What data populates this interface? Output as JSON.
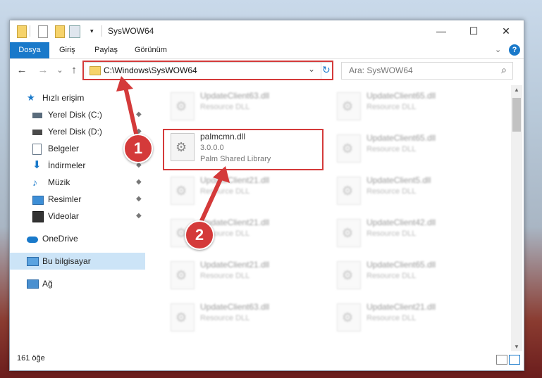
{
  "window": {
    "title": "SysWOW64",
    "minimize_icon": "—",
    "maximize_icon": "☐",
    "close_icon": "✕"
  },
  "ribbon": {
    "tabs": [
      "Dosya",
      "Giriş",
      "Paylaş",
      "Görünüm"
    ],
    "expand_icon": "⌄",
    "help_icon": "?"
  },
  "nav": {
    "back_icon": "←",
    "forward_icon": "→",
    "recent_icon": "⌄",
    "up_icon": "↑",
    "address": "C:\\Windows\\SysWOW64",
    "address_dropdown_icon": "⌄",
    "refresh_icon": "↻",
    "search_placeholder": "Ara: SysWOW64",
    "search_icon": "⌕"
  },
  "sidebar": {
    "items": [
      {
        "label": "Hızlı erişim",
        "icon": "star-icon",
        "pinned": false
      },
      {
        "label": "Yerel Disk (C:)",
        "icon": "drive-icon",
        "pinned": true
      },
      {
        "label": "Yerel Disk (D:)",
        "icon": "drive-icon",
        "pinned": true
      },
      {
        "label": "Belgeler",
        "icon": "documents-icon",
        "pinned": true
      },
      {
        "label": "İndirmeler",
        "icon": "download-icon",
        "pinned": true
      },
      {
        "label": "Müzik",
        "icon": "music-icon",
        "pinned": true
      },
      {
        "label": "Resimler",
        "icon": "pictures-icon",
        "pinned": true
      },
      {
        "label": "Videolar",
        "icon": "videos-icon",
        "pinned": true
      },
      {
        "label": "OneDrive",
        "icon": "cloud-icon",
        "pinned": false
      },
      {
        "label": "Bu bilgisayar",
        "icon": "computer-icon",
        "pinned": false
      },
      {
        "label": "Ağ",
        "icon": "network-icon",
        "pinned": false
      }
    ],
    "pin_glyph": "📌"
  },
  "files": {
    "highlighted": {
      "name": "palmcmn.dll",
      "version": "3.0.0.0",
      "description": "Palm Shared Library"
    },
    "others": [
      {
        "name": "UpdateClient63.dll",
        "description": "Resource DLL"
      },
      {
        "name": "UpdateClient65.dll",
        "description": "Resource DLL"
      },
      {
        "name": "UpdateClient65.dll",
        "description": "Resource DLL"
      },
      {
        "name": "UpdateClient21.dll",
        "description": "Resource DLL"
      },
      {
        "name": "UpdateClient5.dll",
        "description": "Resource DLL"
      },
      {
        "name": "UpdateClient21.dll",
        "description": "Resource DLL"
      },
      {
        "name": "UpdateClient42.dll",
        "description": "Resource DLL"
      },
      {
        "name": "UpdateClient21.dll",
        "description": "Resource DLL"
      },
      {
        "name": "UpdateClient65.dll",
        "description": "Resource DLL"
      },
      {
        "name": "UpdateClient63.dll",
        "description": "Resource DLL"
      },
      {
        "name": "UpdateClient21.dll",
        "description": "Resource DLL"
      }
    ]
  },
  "status": {
    "item_count": "161 öğe"
  },
  "annotations": {
    "callout_1": "1",
    "callout_2": "2"
  },
  "colors": {
    "accent": "#1979ca",
    "highlight": "#d43a3a",
    "selection": "#cce4f7"
  }
}
